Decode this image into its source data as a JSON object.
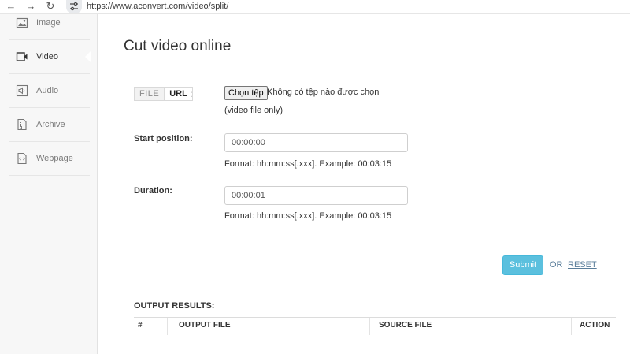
{
  "browser": {
    "url": "https://www.aconvert.com/video/split/",
    "back_icon": "←",
    "forward_icon": "→",
    "reload_icon": "↻"
  },
  "sidebar": {
    "items": [
      {
        "label": "Image",
        "icon": "image-icon"
      },
      {
        "label": "Video",
        "icon": "video-icon",
        "active": true
      },
      {
        "label": "Audio",
        "icon": "audio-icon"
      },
      {
        "label": "Archive",
        "icon": "archive-icon"
      },
      {
        "label": "Webpage",
        "icon": "webpage-icon"
      }
    ]
  },
  "main": {
    "title": "Cut video online",
    "source": {
      "file_option": "FILE",
      "url_option": "URL",
      "colon": ":",
      "choose_button": "Chọn tệp",
      "file_status": "Không có tệp nào được chọn",
      "hint": "(video file only)"
    },
    "start": {
      "label": "Start position:",
      "value": "00:00:00",
      "hint": "Format: hh:mm:ss[.xxx]. Example: 00:03:15"
    },
    "duration": {
      "label": "Duration:",
      "value": "00:00:01",
      "hint": "Format: hh:mm:ss[.xxx]. Example: 00:03:15"
    },
    "submit_label": "Submit",
    "or_label": "OR",
    "reset_label": "RESET",
    "colors": {
      "submit": "#5bc0de",
      "link": "#5a7d9a"
    }
  },
  "output": {
    "title": "OUTPUT RESULTS:",
    "columns": [
      "#",
      "OUTPUT FILE",
      "SOURCE FILE",
      "ACTION"
    ]
  }
}
